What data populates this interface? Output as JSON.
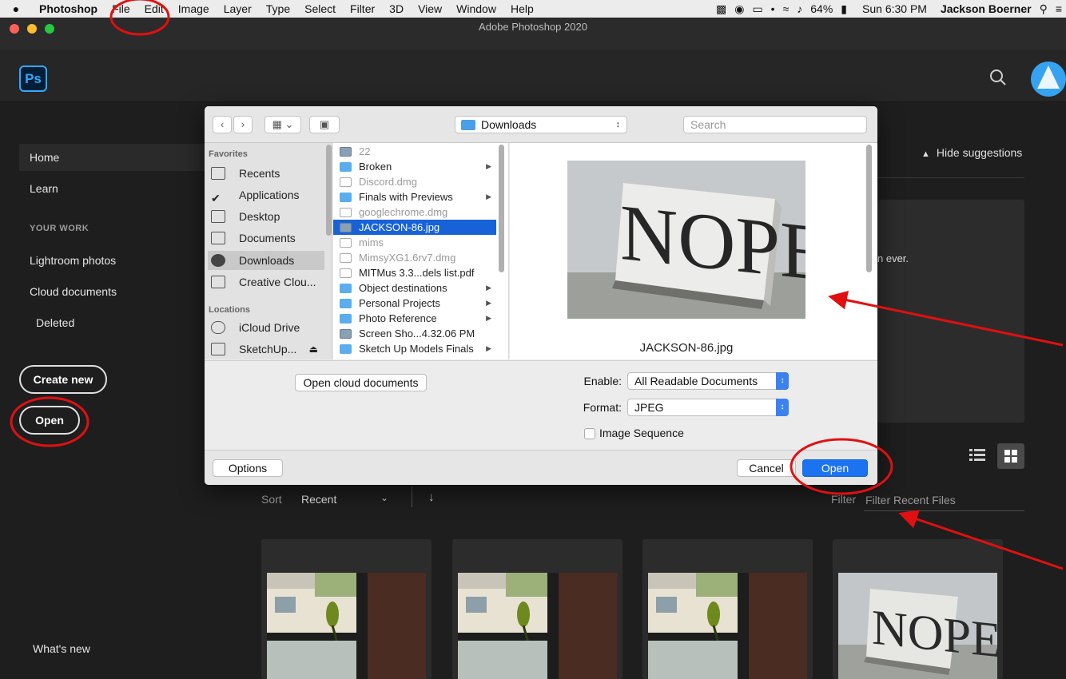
{
  "menubar": {
    "app_name": "Photoshop",
    "items": [
      "File",
      "Edit",
      "Image",
      "Layer",
      "Type",
      "Select",
      "Filter",
      "3D",
      "View",
      "Window",
      "Help"
    ],
    "battery": "64%",
    "clock": "Sun 6:30 PM",
    "user": "Jackson Boerner"
  },
  "window": {
    "title": "Adobe Photoshop 2020"
  },
  "header": {
    "logo": "Ps"
  },
  "sidebar": {
    "home": "Home",
    "learn": "Learn",
    "your_work": "YOUR WORK",
    "lightroom": "Lightroom photos",
    "cloud": "Cloud documents",
    "deleted": "Deleted",
    "create_new": "Create new",
    "open": "Open",
    "whats_new": "What's new"
  },
  "suggestions": {
    "hide": "Hide suggestions",
    "fragment": "n ever."
  },
  "recent": {
    "sort_label": "Sort",
    "sort_value": "Recent",
    "filter_label": "Filter",
    "filter_placeholder": "Filter Recent Files"
  },
  "dialog": {
    "location": "Downloads",
    "search_placeholder": "Search",
    "favorites_header": "Favorites",
    "favorites": [
      "Recents",
      "Applications",
      "Desktop",
      "Documents",
      "Downloads",
      "Creative Clou..."
    ],
    "locations_header": "Locations",
    "locations": [
      "iCloud Drive",
      "SketchUp..."
    ],
    "files": [
      {
        "name": "22",
        "kind": "img",
        "dim": true,
        "arrow": false
      },
      {
        "name": "Broken",
        "kind": "folder",
        "dim": false,
        "arrow": true
      },
      {
        "name": "Discord.dmg",
        "kind": "doc",
        "dim": true,
        "arrow": false
      },
      {
        "name": "Finals with Previews",
        "kind": "folder",
        "dim": false,
        "arrow": true
      },
      {
        "name": "googlechrome.dmg",
        "kind": "doc",
        "dim": true,
        "arrow": false
      },
      {
        "name": "JACKSON-86.jpg",
        "kind": "img",
        "dim": false,
        "arrow": false
      },
      {
        "name": "mims",
        "kind": "doc",
        "dim": true,
        "arrow": false
      },
      {
        "name": "MimsyXG1.6rv7.dmg",
        "kind": "doc",
        "dim": true,
        "arrow": false
      },
      {
        "name": "MITMus 3.3...dels list.pdf",
        "kind": "doc",
        "dim": false,
        "arrow": false
      },
      {
        "name": "Object destinations",
        "kind": "folder",
        "dim": false,
        "arrow": true
      },
      {
        "name": "Personal Projects",
        "kind": "folder",
        "dim": false,
        "arrow": true
      },
      {
        "name": "Photo Reference",
        "kind": "folder",
        "dim": false,
        "arrow": true
      },
      {
        "name": "Screen Sho...4.32.06 PM",
        "kind": "img",
        "dim": false,
        "arrow": false
      },
      {
        "name": "Sketch Up Models Finals",
        "kind": "folder",
        "dim": false,
        "arrow": true
      }
    ],
    "selected_file": "JACKSON-86.jpg",
    "preview_name": "JACKSON-86.jpg",
    "preview_sign_text": "NOPE",
    "open_cloud": "Open cloud documents",
    "enable_label": "Enable:",
    "enable_value": "All Readable Documents",
    "format_label": "Format:",
    "format_value": "JPEG",
    "image_sequence": "Image Sequence",
    "options": "Options",
    "cancel": "Cancel",
    "open": "Open"
  },
  "colors": {
    "ps_blue": "#31a8ff",
    "selection_blue": "#1862d8",
    "annotation_red": "#e01010"
  }
}
